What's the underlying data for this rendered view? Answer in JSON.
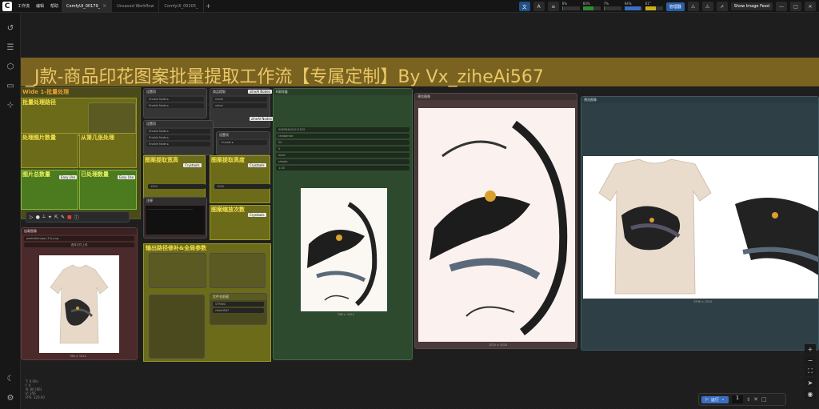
{
  "topbar": {
    "menus": [
      "工作流",
      "编辑",
      "帮助"
    ],
    "tabs": [
      {
        "label": "ComfyUI_00179_",
        "active": true
      },
      {
        "label": "Unsaved Workflow",
        "active": false
      },
      {
        "label": "ComfyUI_00205_",
        "active": false
      }
    ],
    "meters": [
      {
        "label": "CPU",
        "value": "6%",
        "level": 6
      },
      {
        "label": "RAM",
        "value": "60%",
        "level": 60
      },
      {
        "label": "GPU",
        "value": "7%",
        "level": 7
      },
      {
        "label": "VRAM",
        "value": "94%",
        "level": 94
      },
      {
        "label": "Temp",
        "value": "61°",
        "level": 61
      }
    ],
    "manager_label": "管理器",
    "feed_label": "Show Image Feed",
    "accent": "#2a5fa8"
  },
  "workflow_title": "_J款-商品印花图案批量提取工作流【专属定制】By Vx_ziheAi567",
  "group_labels": {
    "batch": "Wide 1-批量处理",
    "batch_path": "批量处理路径",
    "process_count": "处理图片数量",
    "start_from": "从第几张处理",
    "image_count": "图片总数量",
    "end_count": "已处理数量",
    "pattern_ratio": "图案提取宽高",
    "pattern_scale": "图案提取高度",
    "image_scale": "图案缩放次数",
    "output_panel": "输出路径修补&全局参数",
    "note_title": "注释"
  },
  "nodes": {
    "load_image": "加载图像",
    "load_image_file": "pasted/image (15).png",
    "upload_btn": "选择文件上传",
    "preview_title": "预览图像",
    "ksampler": "K采样器",
    "preview_image": "预览图像",
    "ziheai_nodes": "ziheAI Nodes",
    "easy_use": "Easy Use",
    "crystools": "Crystools",
    "string_label": "STRING",
    "string_value": "ziheAi567",
    "size_val": "1024",
    "cfg": "5",
    "seed": "508284641211015",
    "steps": "20",
    "sampler": "euler",
    "scheduler": "simple",
    "denoise": "1.00",
    "control": "randomize"
  },
  "image_captions": {
    "thumb": "768 × 1024",
    "mid": "768 × 1024",
    "large": "1024 × 1024",
    "right": "1536 × 1024"
  },
  "run": {
    "label": "运行",
    "count": "1"
  },
  "stats": [
    "T: 0.00s",
    "I: 0",
    "N: 86 [86]",
    "V: 356",
    "FPS: 120.00"
  ]
}
